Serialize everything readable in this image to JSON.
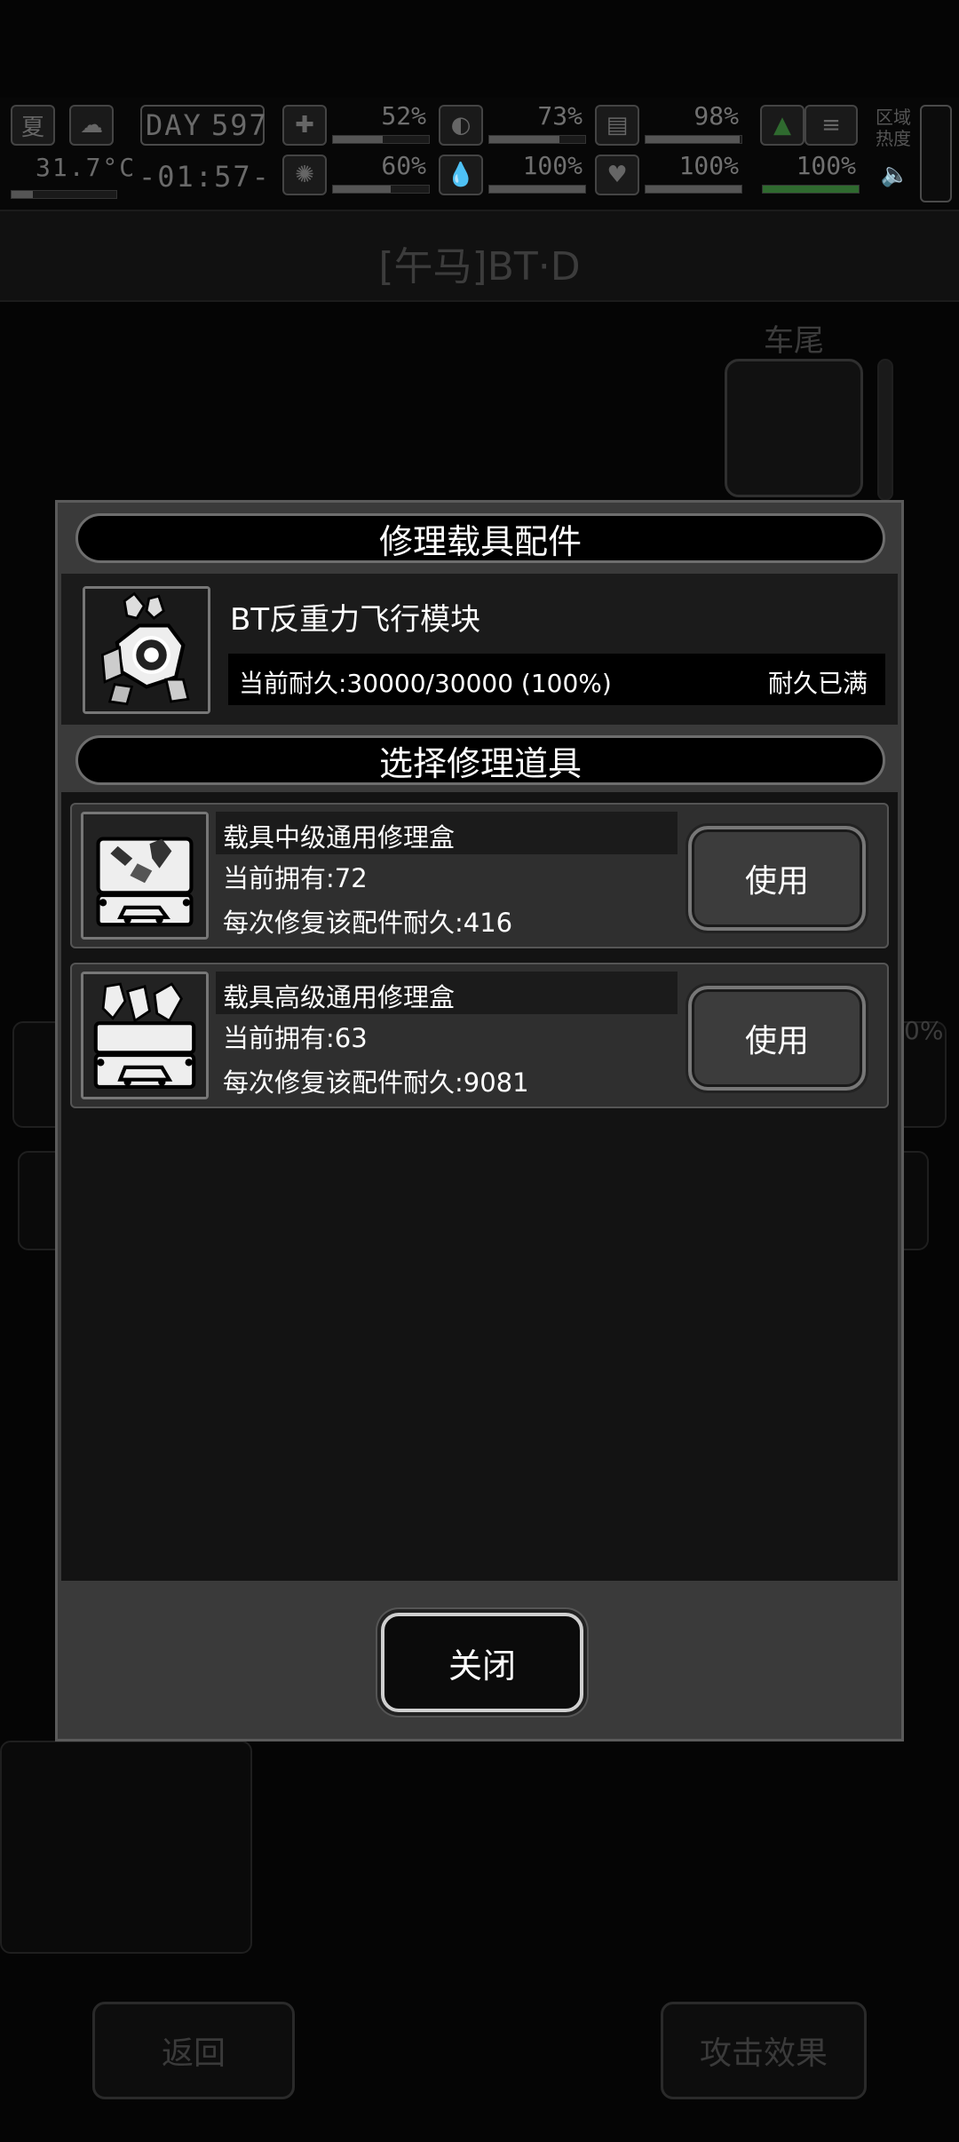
{
  "status": {
    "season": "夏",
    "day_label": "DAY",
    "day_value": "597",
    "temperature": "31.7°C",
    "clock": "-01:57-",
    "stats_top": [
      "52%",
      "73%",
      "98%"
    ],
    "stats_top_fill": [
      0.52,
      0.73,
      0.98
    ],
    "stats_bottom": [
      "60%",
      "100%",
      "100%",
      "100%"
    ],
    "stats_bottom_fill": [
      0.6,
      1.0,
      1.0,
      1.0
    ],
    "zone_label": "区域热度",
    "icons": [
      "sun-icon",
      "weather-icon",
      "medkit-icon",
      "stomach-icon",
      "bladder-icon",
      "flag-icon",
      "brain-icon",
      "water-drop-icon",
      "heart-icon",
      "speaker-icon"
    ]
  },
  "background": {
    "title": "[午马]BT·D",
    "slot_label": "车尾",
    "back_button": "返回",
    "effect_button": "攻击效果",
    "partial_pct": "0%"
  },
  "dialog": {
    "title": "修理载具配件",
    "part": {
      "name": "BT反重力飞行模块",
      "durability": "当前耐久:30000/30000 (100%)",
      "durability_fill": 1.0,
      "status": "耐久已满",
      "icon": "turret-part-icon"
    },
    "select_title": "选择修理道具",
    "tools": [
      {
        "name": "载具中级通用修理盒",
        "owned": "当前拥有:72",
        "repair": "每次修复该配件耐久:416",
        "button": "使用",
        "icon": "repair-box-icon"
      },
      {
        "name": "载具高级通用修理盒",
        "owned": "当前拥有:63",
        "repair": "每次修复该配件耐久:9081",
        "button": "使用",
        "icon": "advanced-repair-box-icon"
      }
    ],
    "close_button": "关闭"
  },
  "colors": {
    "dialog_frame": "#3a3a3a",
    "header_bg": "#000000",
    "list_bg": "#131313",
    "row_bg": "#2f2f2f",
    "text": "#ffffff"
  }
}
